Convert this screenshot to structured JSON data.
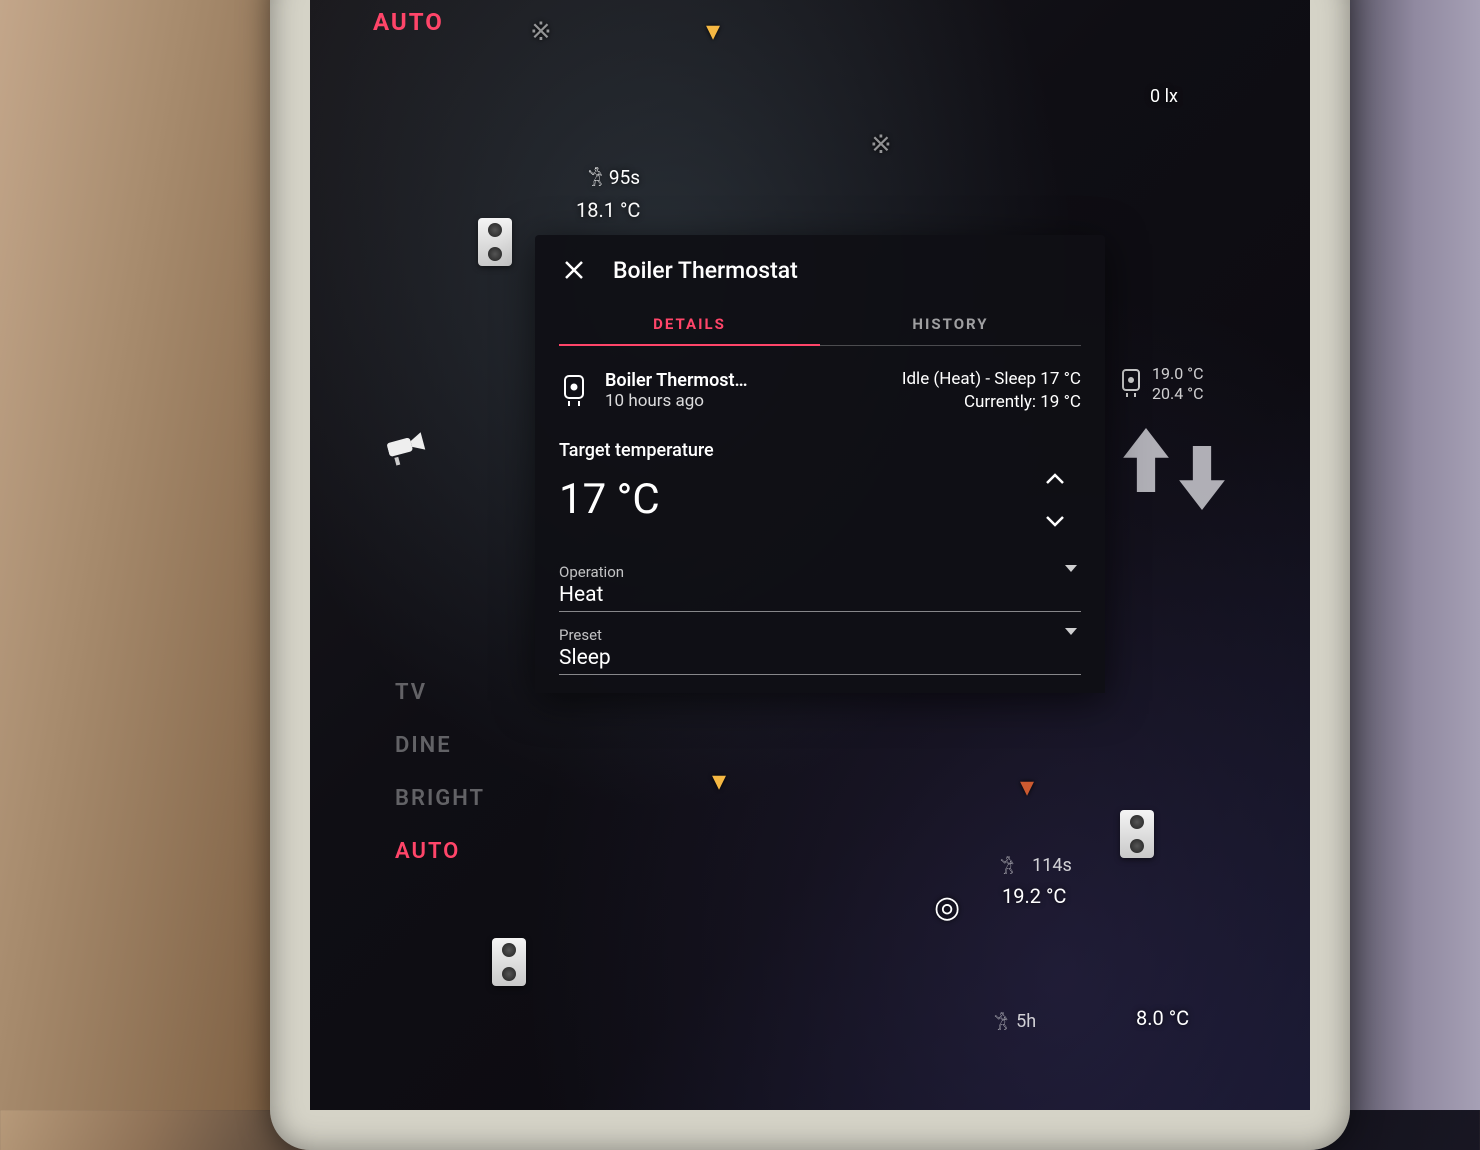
{
  "scenes": {
    "top_auto": "AUTO",
    "items": [
      "TV",
      "DINE",
      "BRIGHT",
      "AUTO"
    ],
    "active_index": 3
  },
  "floorplan": {
    "motion_hall": "95s",
    "temp_hall": "18.1 °C",
    "lux_right": "0 lx",
    "sensor_right": {
      "line1": "19.0 °C",
      "line2": "20.4 °C"
    },
    "motion_living": "114s",
    "temp_living": "19.2 °C",
    "temp_br": "8.0 °C",
    "time_br": "5h"
  },
  "card": {
    "title": "Boiler Thermostat",
    "tabs": {
      "details": "DETAILS",
      "history": "HISTORY"
    },
    "entity_name": "Boiler Thermost…",
    "last_changed": "10 hours ago",
    "state_line1": "Idle (Heat) - Sleep 17 °C",
    "state_line2": "Currently: 19 °C",
    "target_label": "Target temperature",
    "target_value": "17 °C",
    "operation": {
      "label": "Operation",
      "value": "Heat"
    },
    "preset": {
      "label": "Preset",
      "value": "Sleep"
    }
  }
}
